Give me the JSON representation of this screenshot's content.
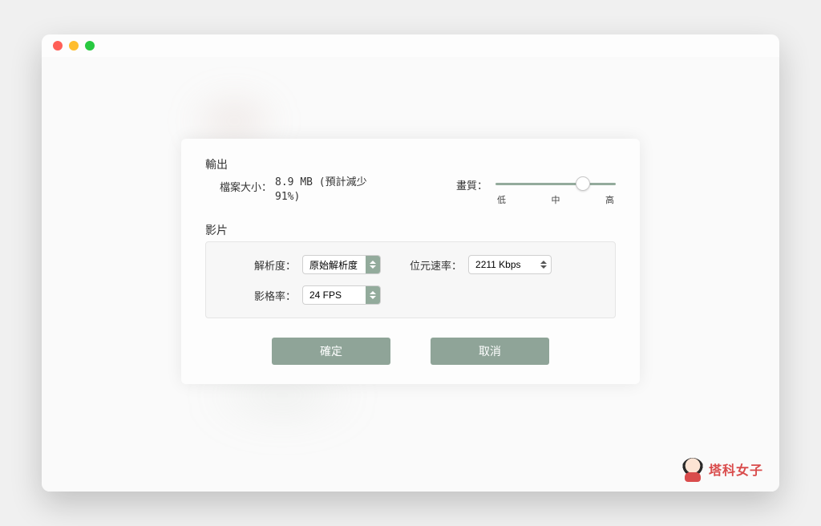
{
  "output": {
    "section_title": "輸出",
    "filesize_label": "檔案大小：",
    "filesize_value": "8.9 MB (預計減少91%)",
    "quality_label": "畫質：",
    "slider_ticks": {
      "low": "低",
      "mid": "中",
      "high": "高"
    }
  },
  "video": {
    "section_title": "影片",
    "resolution_label": "解析度：",
    "resolution_value": "原始解析度",
    "bitrate_label": "位元速率：",
    "bitrate_value": "2211 Kbps",
    "framerate_label": "影格率：",
    "framerate_value": "24 FPS"
  },
  "buttons": {
    "ok": "確定",
    "cancel": "取消"
  },
  "brand": {
    "text": "塔科女子"
  }
}
